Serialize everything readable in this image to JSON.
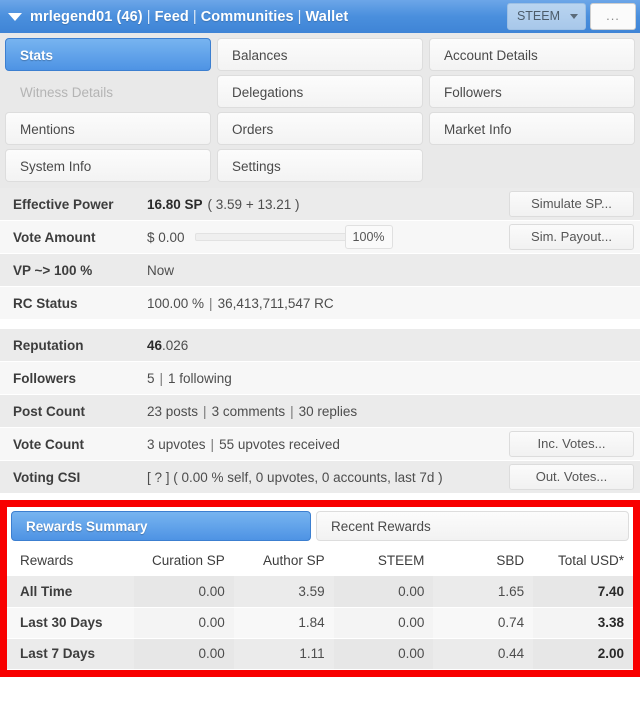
{
  "header": {
    "caret_icon": "caret-down-icon",
    "account": "mrlegend01 (46)",
    "links": [
      "Feed",
      "Communities",
      "Wallet"
    ],
    "separator": "|",
    "currency_select": "STEEM",
    "more_button": "..."
  },
  "tabs": [
    {
      "label": "Stats",
      "state": "active"
    },
    {
      "label": "Balances",
      "state": "normal"
    },
    {
      "label": "Account Details",
      "state": "normal"
    },
    {
      "label": "Witness Details",
      "state": "disabled"
    },
    {
      "label": "Delegations",
      "state": "normal"
    },
    {
      "label": "Followers",
      "state": "normal"
    },
    {
      "label": "Mentions",
      "state": "normal"
    },
    {
      "label": "Orders",
      "state": "normal"
    },
    {
      "label": "Market Info",
      "state": "normal"
    },
    {
      "label": "System Info",
      "state": "normal"
    },
    {
      "label": "Settings",
      "state": "normal"
    },
    {
      "label": "",
      "state": "empty"
    }
  ],
  "stats_block_1": [
    {
      "label": "Effective Power",
      "value_strong": "16.80 SP",
      "value_rest": "( 3.59 + 13.21 )",
      "button": "Simulate SP..."
    },
    {
      "label": "Vote Amount",
      "value_strong": "$ 0.00",
      "slider_percent": "100%",
      "button": "Sim. Payout..."
    },
    {
      "label": "VP ~> 100 %",
      "value_rest": "Now"
    },
    {
      "label": "RC Status",
      "value_rest": "100.00 %",
      "value_sep": "|",
      "value_rest2": "36,413,711,547 RC"
    }
  ],
  "stats_block_2": [
    {
      "label": "Reputation",
      "value_strong": "46",
      "value_rest": ".026"
    },
    {
      "label": "Followers",
      "value_rest": "5",
      "value_sep": "|",
      "value_rest2": "1 following"
    },
    {
      "label": "Post Count",
      "value_rest": "23 posts",
      "value_sep": "|",
      "value_rest2": "3 comments",
      "value_sep2": "|",
      "value_rest3": "30 replies"
    },
    {
      "label": "Vote Count",
      "value_rest": "3 upvotes",
      "value_sep": "|",
      "value_rest2": "55 upvotes received",
      "button": "Inc. Votes..."
    },
    {
      "label": "Voting CSI",
      "value_rest": "[ ? ] ( 0.00 % self, 0 upvotes, 0 accounts, last 7d )",
      "button": "Out. Votes..."
    }
  ],
  "rewards_panel": {
    "tabs": [
      {
        "label": "Rewards Summary",
        "state": "active"
      },
      {
        "label": "Recent Rewards",
        "state": "inactive"
      }
    ],
    "columns": [
      "Rewards",
      "Curation SP",
      "Author SP",
      "STEEM",
      "SBD",
      "Total USD*"
    ],
    "rows": [
      {
        "label": "All Time",
        "curation_sp": "0.00",
        "author_sp": "3.59",
        "steem": "0.00",
        "sbd": "1.65",
        "total_usd": "7.40"
      },
      {
        "label": "Last 30 Days",
        "curation_sp": "0.00",
        "author_sp": "1.84",
        "steem": "0.00",
        "sbd": "0.74",
        "total_usd": "3.38"
      },
      {
        "label": "Last 7 Days",
        "curation_sp": "0.00",
        "author_sp": "1.11",
        "steem": "0.00",
        "sbd": "0.44",
        "total_usd": "2.00"
      }
    ]
  },
  "colors": {
    "header_blue": "#4a8fdd",
    "active_tab_blue": "#4e93e4",
    "highlight_red": "#f80000",
    "row_alt": "#ebebeb"
  }
}
